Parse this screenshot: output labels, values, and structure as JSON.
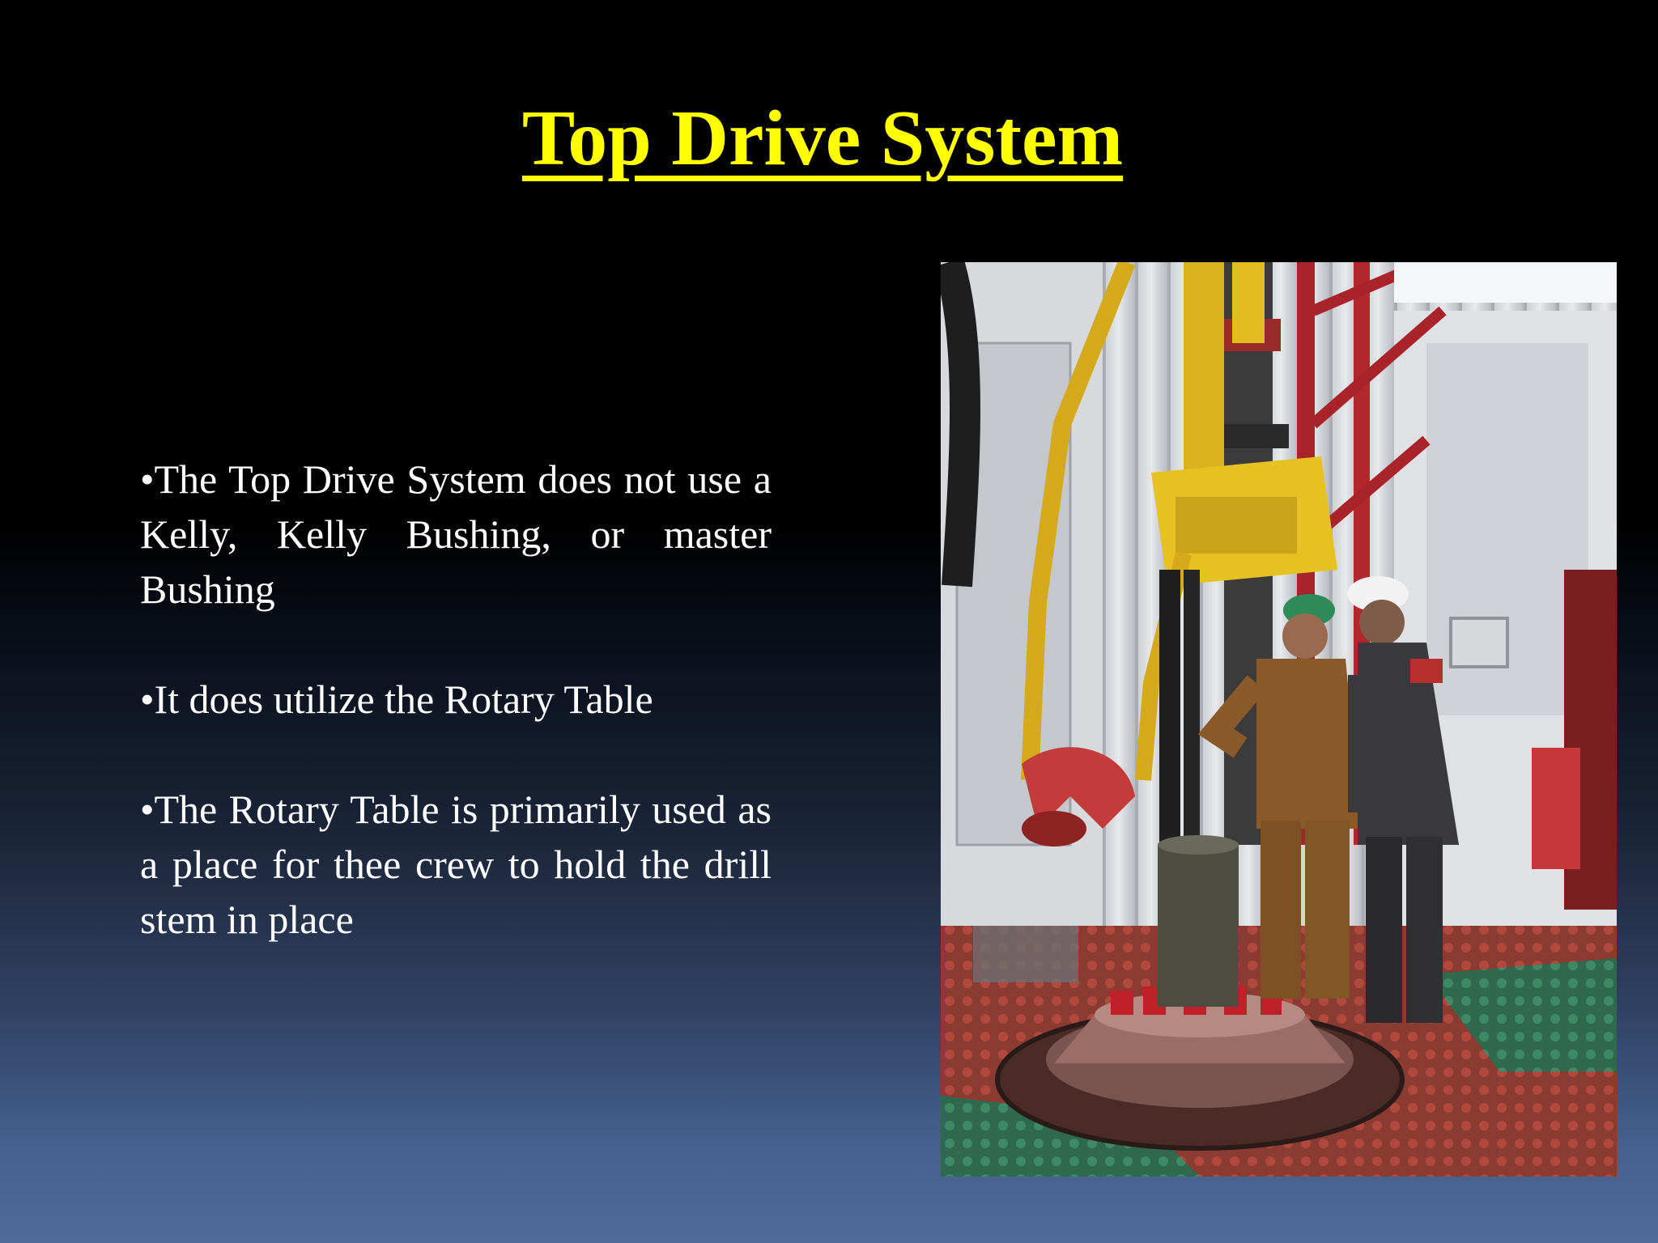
{
  "slide": {
    "title": "Top Drive System",
    "bullets": [
      "•The Top Drive System does not use  a Kelly, Kelly Bushing, or master Bushing",
      "•It does utilize the Rotary Table",
      "•The Rotary Table is primarily used as a place for thee crew to hold the drill stem in place"
    ]
  },
  "colors": {
    "title": "#ffff00",
    "body_text": "#ffffff",
    "background_top": "#000000",
    "background_bottom": "#50699a"
  },
  "photo": {
    "subject": "drilling-rig-floor-top-drive-with-two-workers"
  }
}
